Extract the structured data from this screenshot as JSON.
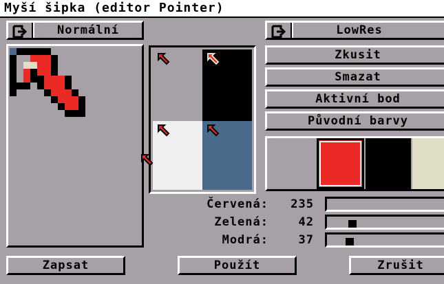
{
  "window": {
    "title": "Myší šipka (editor Pointer)"
  },
  "mode_cycle": {
    "label": "Normální",
    "icon": "cycle-icon"
  },
  "res_cycle": {
    "label": "LowRes",
    "icon": "cycle-icon"
  },
  "buttons": {
    "test": "Zkusit",
    "clear": "Smazat",
    "hotspot": "Aktivní bod",
    "reset_colors": "Původní barvy"
  },
  "sliders": {
    "red": {
      "label": "Červená:",
      "value": "235",
      "fraction": 1.0
    },
    "green": {
      "label": "Zelená:",
      "value": "42",
      "fraction": 0.17
    },
    "blue": {
      "label": "Modrá:",
      "value": "37",
      "fraction": 0.15
    }
  },
  "footer": {
    "save": "Zapsat",
    "use": "Použít",
    "cancel": "Zrušit"
  },
  "colors": {
    "background": "#a7a0a7",
    "red": "#eb2a25",
    "black": "#000000",
    "cream": "#e0dec4",
    "preview_gray": "#a7a0a7",
    "preview_black": "#000000",
    "preview_white": "#f0f0f0",
    "preview_blue": "#4a6a8c",
    "hotspot": "#4a6a8c"
  },
  "pointer_image": [
    "h55555",
    "5aa2225",
    "5a33225",
    "5a25225",
    "5a2552225",
    "555 52225",
    "5    52225",
    "      52225",
    "       5225",
    "        555"
  ]
}
